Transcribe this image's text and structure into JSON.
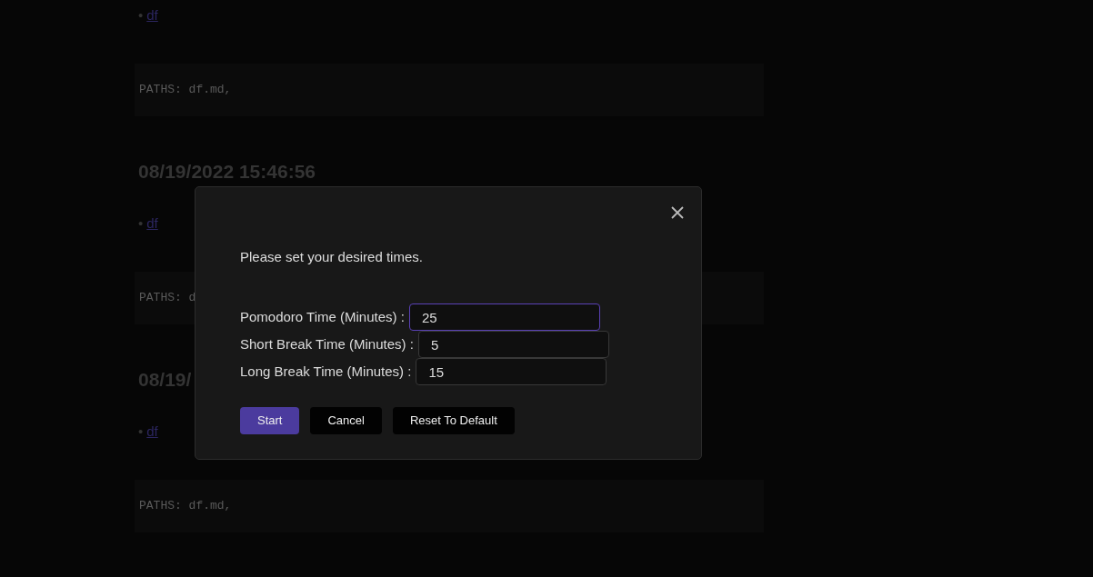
{
  "notes": [
    {
      "kind": "link",
      "bullet": "•",
      "text": "df"
    },
    {
      "kind": "code",
      "text": "PATHS: df.md,"
    },
    {
      "kind": "heading",
      "text": "08/19/2022 15:46:56"
    },
    {
      "kind": "link",
      "bullet": "•",
      "text": "df"
    },
    {
      "kind": "code",
      "text": "PATHS: d"
    },
    {
      "kind": "heading",
      "text": "08/19/"
    },
    {
      "kind": "link",
      "bullet": "•",
      "text": "df"
    },
    {
      "kind": "code",
      "text": "PATHS: df.md,"
    }
  ],
  "dialog": {
    "message": "Please set your desired times.",
    "fields": [
      {
        "label": "Pomodoro Time (Minutes) :",
        "value": "25",
        "focused": true
      },
      {
        "label": "Short Break Time (Minutes) :",
        "value": "5",
        "focused": false
      },
      {
        "label": "Long Break Time (Minutes) :",
        "value": "15",
        "focused": false
      }
    ],
    "buttons": [
      {
        "label": "Start",
        "kind": "primary"
      },
      {
        "label": "Cancel",
        "kind": "secondary"
      },
      {
        "label": "Reset To Default",
        "kind": "secondary"
      }
    ]
  }
}
